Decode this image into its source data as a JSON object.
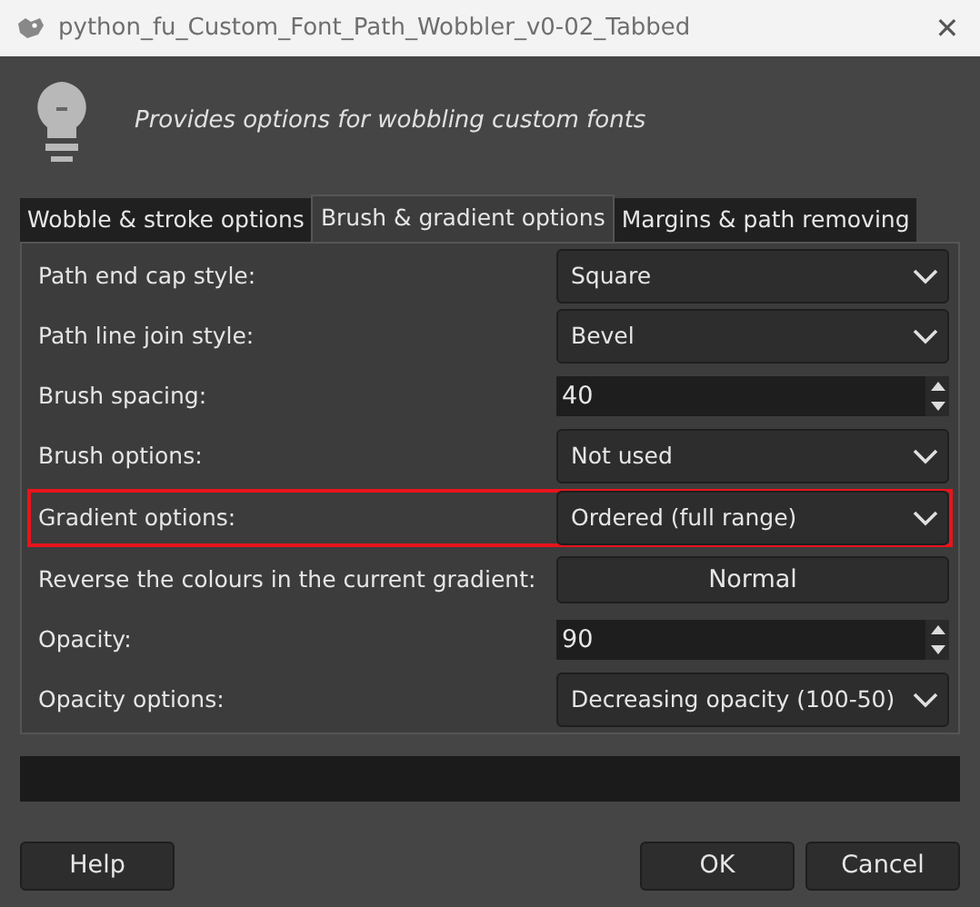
{
  "window": {
    "title": "python_fu_Custom_Font_Path_Wobbler_v0-02_Tabbed",
    "close": "✕"
  },
  "header": {
    "description": "Provides options for wobbling custom fonts"
  },
  "tabs": [
    {
      "label": "Wobble & stroke options",
      "selected": false
    },
    {
      "label": "Brush & gradient options",
      "selected": true
    },
    {
      "label": "Margins & path removing",
      "selected": false
    }
  ],
  "rows": [
    {
      "label": "Path end cap style:",
      "kind": "combo",
      "value": "Square",
      "highlighted": false
    },
    {
      "label": "Path line join style:",
      "kind": "combo",
      "value": "Bevel",
      "highlighted": false
    },
    {
      "label": "Brush spacing:",
      "kind": "spin",
      "value": "40",
      "highlighted": false
    },
    {
      "label": "Brush options:",
      "kind": "combo",
      "value": "Not used",
      "highlighted": false
    },
    {
      "label": "Gradient options:",
      "kind": "combo",
      "value": "Ordered (full range)",
      "highlighted": true
    },
    {
      "label": "Reverse the colours in the current gradient:",
      "kind": "button",
      "value": "Normal",
      "highlighted": false
    },
    {
      "label": "Opacity:",
      "kind": "spin",
      "value": "90",
      "highlighted": false
    },
    {
      "label": "Opacity options:",
      "kind": "combo",
      "value": "Decreasing opacity (100-50)",
      "highlighted": false
    }
  ],
  "buttons": {
    "left": [
      "Help"
    ],
    "right": [
      "OK",
      "Cancel"
    ]
  }
}
